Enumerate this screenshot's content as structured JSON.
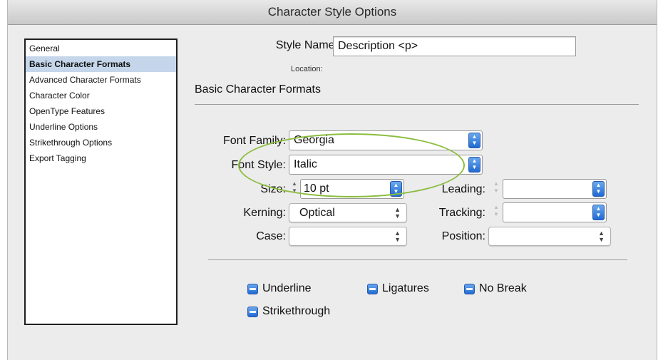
{
  "window": {
    "title": "Character Style Options"
  },
  "sidebar": {
    "items": [
      {
        "label": "General",
        "selected": false
      },
      {
        "label": "Basic Character Formats",
        "selected": true
      },
      {
        "label": "Advanced Character Formats",
        "selected": false
      },
      {
        "label": "Character Color",
        "selected": false
      },
      {
        "label": "OpenType Features",
        "selected": false
      },
      {
        "label": "Underline Options",
        "selected": false
      },
      {
        "label": "Strikethrough Options",
        "selected": false
      },
      {
        "label": "Export Tagging",
        "selected": false
      }
    ]
  },
  "header": {
    "style_name_label": "Style Name:",
    "style_name_value": "Description <p>",
    "location_label": "Location:"
  },
  "section": {
    "title": "Basic Character Formats"
  },
  "fields": {
    "font_family": {
      "label": "Font Family:",
      "value": "Georgia"
    },
    "font_style": {
      "label": "Font Style:",
      "value": "Italic"
    },
    "size": {
      "label": "Size:",
      "value": "10 pt"
    },
    "leading": {
      "label": "Leading:",
      "value": ""
    },
    "kerning": {
      "label": "Kerning:",
      "value": "Optical"
    },
    "tracking": {
      "label": "Tracking:",
      "value": ""
    },
    "case": {
      "label": "Case:",
      "value": ""
    },
    "position": {
      "label": "Position:",
      "value": ""
    }
  },
  "checkboxes": {
    "underline": {
      "label": "Underline",
      "state": "mixed"
    },
    "ligatures": {
      "label": "Ligatures",
      "state": "mixed"
    },
    "no_break": {
      "label": "No Break",
      "state": "mixed"
    },
    "strikethrough": {
      "label": "Strikethrough",
      "state": "mixed"
    }
  },
  "colors": {
    "selection": "#c5d6ea",
    "accent": "#1f6ad3",
    "annotation_oval": "#8bbd3f"
  },
  "icons": {
    "combo_arrows": "up-down-arrows-icon",
    "stepper": "stepper-icon",
    "mixed_checkbox": "mixed-checkbox-icon"
  }
}
